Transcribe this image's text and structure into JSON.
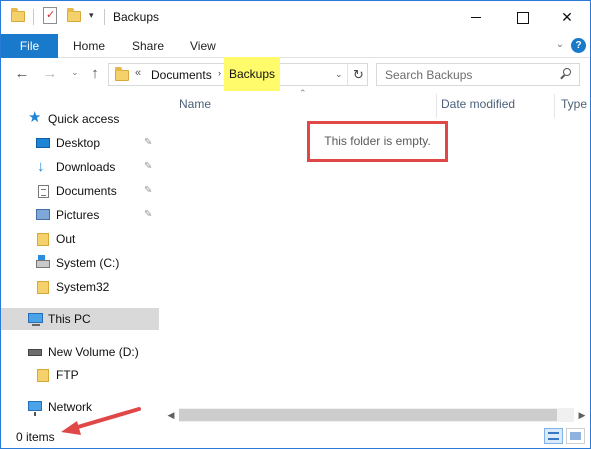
{
  "window": {
    "title": "Backups",
    "controls": {
      "minimize": "minimize",
      "maximize": "maximize",
      "close": "✕"
    }
  },
  "quick_access_toolbar": {
    "dropdown_glyph": "▾"
  },
  "ribbon": {
    "tabs": [
      {
        "label": "File"
      },
      {
        "label": "Home"
      },
      {
        "label": "Share"
      },
      {
        "label": "View"
      }
    ],
    "collapse_glyph": "⌄",
    "help_glyph": "?"
  },
  "nav": {
    "back_glyph": "←",
    "forward_glyph": "→",
    "recent_glyph": "⌄",
    "up_glyph": "↑"
  },
  "address": {
    "overflow": "«",
    "segments": [
      "Documents",
      "Backups"
    ],
    "separator": "›",
    "dropdown_glyph": "⌄",
    "refresh_glyph": "↻"
  },
  "search": {
    "placeholder": "Search Backups"
  },
  "navpane": {
    "quick_access": "Quick access",
    "items": [
      {
        "label": "Desktop",
        "pinned": true
      },
      {
        "label": "Downloads",
        "pinned": true
      },
      {
        "label": "Documents",
        "pinned": true
      },
      {
        "label": "Pictures",
        "pinned": true
      },
      {
        "label": "Out",
        "pinned": false
      },
      {
        "label": "System (C:)",
        "pinned": false
      },
      {
        "label": "System32",
        "pinned": false
      }
    ],
    "this_pc": "This PC",
    "volume": "New Volume (D:)",
    "volume_child": "FTP",
    "network": "Network",
    "pin_glyph": "✎"
  },
  "content": {
    "columns": [
      "Name",
      "Date modified",
      "Type"
    ],
    "sort_glyph": "⌃",
    "empty_message": "This folder is empty."
  },
  "scrollbar": {
    "left": "◀",
    "right": "▶"
  },
  "status": {
    "items_text": "0 items"
  },
  "colors": {
    "accent": "#1979ca",
    "highlight": "#fffb6b",
    "annotation": "#e04848",
    "selected": "#d9d9d9"
  }
}
